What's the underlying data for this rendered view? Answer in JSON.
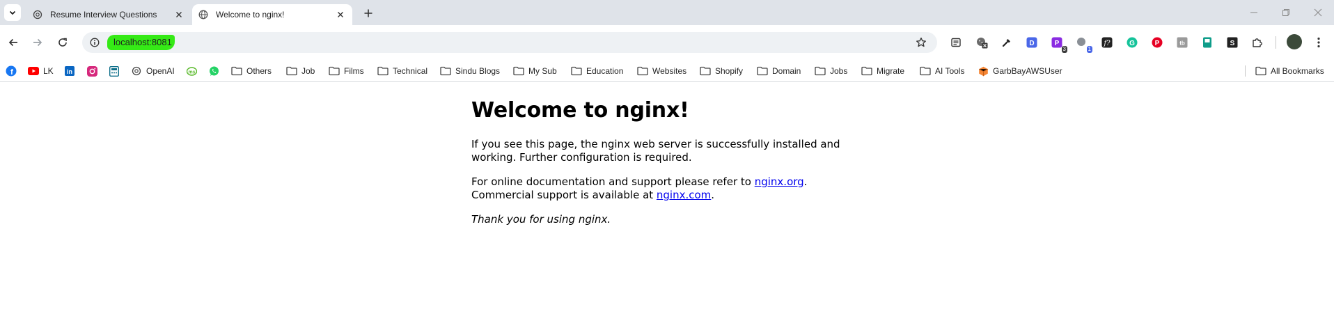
{
  "tabs": [
    {
      "title": "Resume Interview Questions",
      "favicon": "openai-icon",
      "active": false
    },
    {
      "title": "Welcome to nginx!",
      "favicon": "globe-icon",
      "active": true
    }
  ],
  "address_bar": {
    "url": "localhost:8081",
    "highlight_color": "#35ea16"
  },
  "extensions": [
    {
      "name": "reader-mode-icon"
    },
    {
      "name": "cookie-x-icon"
    },
    {
      "name": "eyedropper-icon"
    },
    {
      "name": "d-extension-icon",
      "color": "#4a67e8"
    },
    {
      "name": "purple-extension-icon",
      "color": "#8a2be2",
      "badge": "3"
    },
    {
      "name": "gray-extension-icon",
      "badge": "1"
    },
    {
      "name": "font-f-icon"
    },
    {
      "name": "grammarly-icon",
      "color": "#15c39a"
    },
    {
      "name": "pinterest-icon",
      "color": "#e60023"
    },
    {
      "name": "tb-extension-icon"
    },
    {
      "name": "teal-extension-icon",
      "color": "#0f9d8a"
    },
    {
      "name": "s-extension-icon"
    },
    {
      "name": "puzzle-extensions-icon"
    }
  ],
  "bookmarks": [
    {
      "label": "",
      "icon": "facebook-icon"
    },
    {
      "label": "LK",
      "icon": "youtube-icon"
    },
    {
      "label": "",
      "icon": "linkedin-icon"
    },
    {
      "label": "",
      "icon": "instagram-icon"
    },
    {
      "label": "",
      "icon": "calculator-icon"
    },
    {
      "label": "OpenAI",
      "icon": "openai-icon"
    },
    {
      "label": "",
      "icon": "ms-icon"
    },
    {
      "label": "",
      "icon": "whatsapp-icon"
    },
    {
      "label": "Others",
      "icon": "folder-icon"
    },
    {
      "label": "Job",
      "icon": "folder-icon"
    },
    {
      "label": "Films",
      "icon": "folder-icon"
    },
    {
      "label": "Technical",
      "icon": "folder-icon"
    },
    {
      "label": "Sindu Blogs",
      "icon": "folder-icon"
    },
    {
      "label": "My Sub",
      "icon": "folder-icon"
    },
    {
      "label": "Education",
      "icon": "folder-icon"
    },
    {
      "label": "Websites",
      "icon": "folder-icon"
    },
    {
      "label": "Shopify",
      "icon": "folder-icon"
    },
    {
      "label": "Domain",
      "icon": "folder-icon"
    },
    {
      "label": "Jobs",
      "icon": "folder-icon"
    },
    {
      "label": "Migrate",
      "icon": "folder-icon"
    },
    {
      "label": "AI Tools",
      "icon": "folder-icon"
    },
    {
      "label": "GarbBayAWSUser",
      "icon": "aws-cube-icon"
    }
  ],
  "all_bookmarks": {
    "label": "All Bookmarks",
    "icon": "folder-icon"
  },
  "page": {
    "heading": "Welcome to nginx!",
    "para1": "If you see this page, the nginx web server is successfully installed and working. Further configuration is required.",
    "para2_prefix": "For online documentation and support please refer to ",
    "link1": "nginx.org",
    "para2_mid": ".",
    "para3_prefix": "Commercial support is available at ",
    "link2": "nginx.com",
    "para3_suffix": ".",
    "thanks": "Thank you for using nginx."
  }
}
